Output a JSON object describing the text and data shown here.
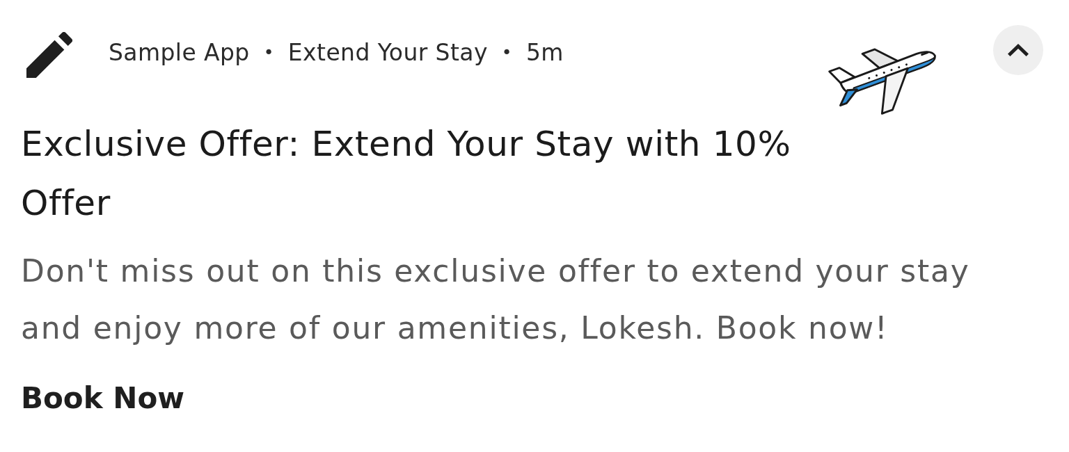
{
  "notification": {
    "meta": [
      {
        "kind": "app_name",
        "text": "Sample App"
      },
      {
        "kind": "separator",
        "text": "•"
      },
      {
        "kind": "channel",
        "text": "Extend Your Stay"
      },
      {
        "kind": "separator",
        "text": "•"
      },
      {
        "kind": "time",
        "text": "5m"
      }
    ],
    "expanded": true,
    "title": "Exclusive Offer: Extend Your Stay with 10% Offer",
    "body": "Don't miss out on this exclusive offer to extend your stay and enjoy more of our amenities, Lokesh. Book now!",
    "actions": [
      "Book Now"
    ]
  }
}
